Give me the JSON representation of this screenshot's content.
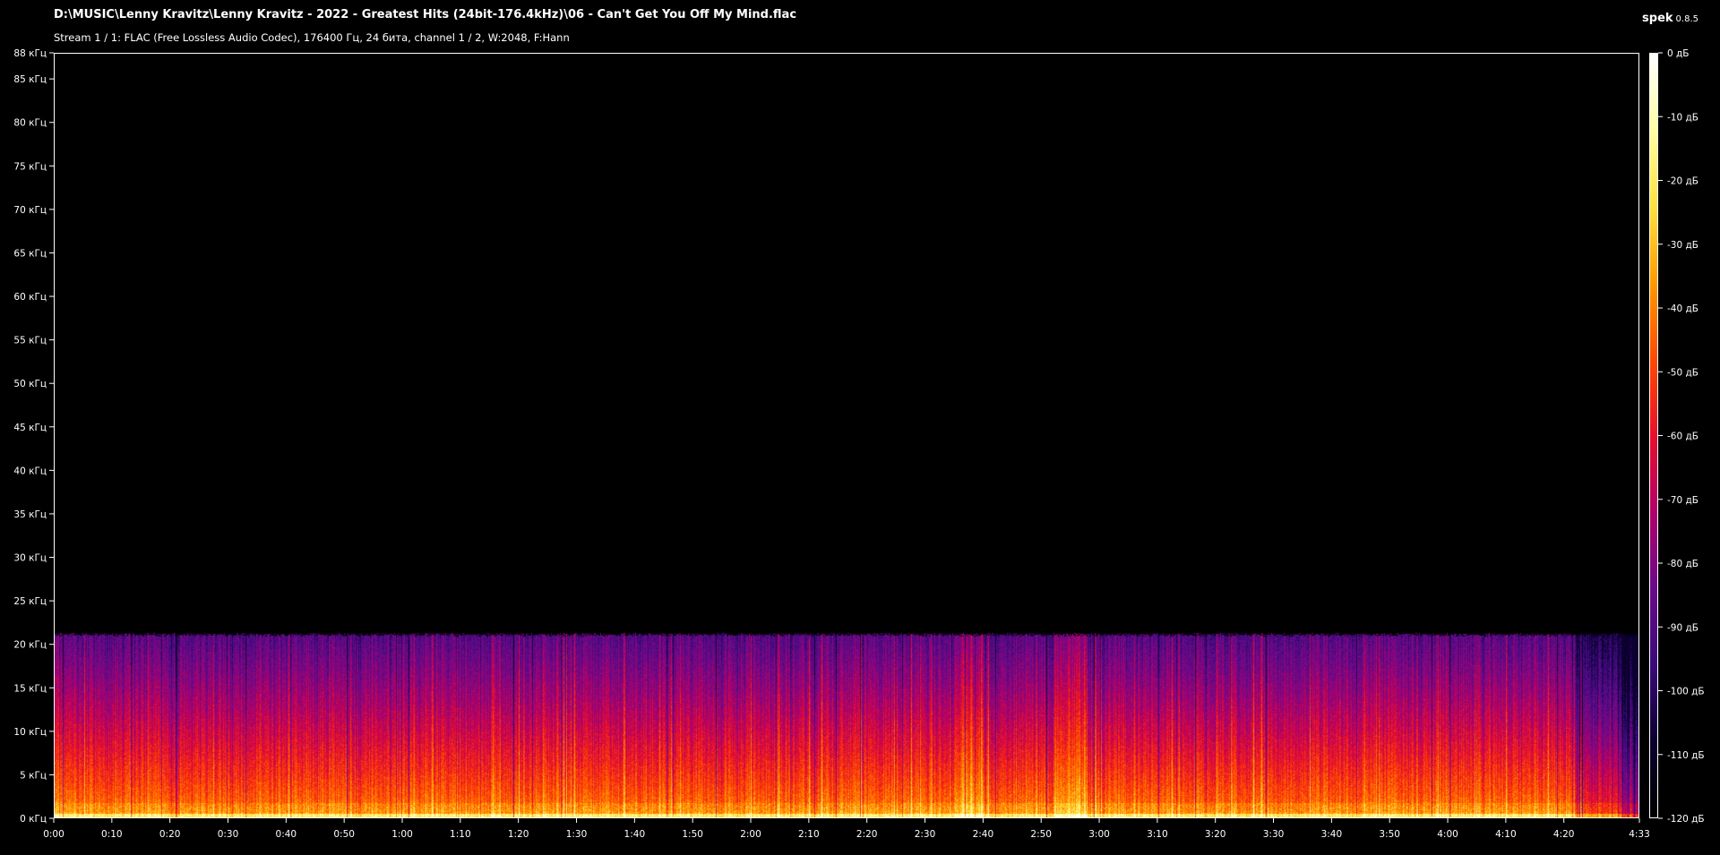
{
  "window": {
    "file_title": "D:\\MUSIC\\Lenny Kravitz\\Lenny Kravitz - 2022 - Greatest Hits (24bit-176.4kHz)\\06 - Can't Get You Off My Mind.flac",
    "stream_info": "Stream 1 / 1: FLAC (Free Lossless Audio Codec), 176400 Гц, 24 бита, channel 1 / 2, W:2048, F:Hann",
    "app_name": "spek",
    "app_version": "0.8.5"
  },
  "colors": {
    "background": "#000000",
    "axis": "#ffffff",
    "palette": [
      "#000000",
      "#0b0030",
      "#3a0a7a",
      "#6a0a8a",
      "#b0006a",
      "#e8102a",
      "#ff4a00",
      "#ff9a00",
      "#ffe040",
      "#ffffa0",
      "#ffffff"
    ]
  },
  "chart_data": {
    "type": "heatmap",
    "title": "",
    "xlabel": "",
    "ylabel": "",
    "x_ticks": [
      "0:00",
      "0:10",
      "0:20",
      "0:30",
      "0:40",
      "0:50",
      "1:00",
      "1:10",
      "1:20",
      "1:30",
      "1:40",
      "1:50",
      "2:00",
      "2:10",
      "2:20",
      "2:30",
      "2:40",
      "2:50",
      "3:00",
      "3:10",
      "3:20",
      "3:30",
      "3:40",
      "3:50",
      "4:00",
      "4:10",
      "4:20",
      "4:33"
    ],
    "x_range_seconds": [
      0,
      273
    ],
    "y_ticks": [
      "0 кГц",
      "5 кГц",
      "10 кГц",
      "15 кГц",
      "20 кГц",
      "25 кГц",
      "30 кГц",
      "35 кГц",
      "40 кГц",
      "45 кГц",
      "50 кГц",
      "55 кГц",
      "60 кГц",
      "65 кГц",
      "70 кГц",
      "75 кГц",
      "80 кГц",
      "85 кГц",
      "88 кГц"
    ],
    "y_range_khz": [
      0,
      88
    ],
    "colorbar_ticks": [
      "0 дБ",
      "-10 дБ",
      "-20 дБ",
      "-30 дБ",
      "-40 дБ",
      "-50 дБ",
      "-60 дБ",
      "-70 дБ",
      "-80 дБ",
      "-90 дБ",
      "-100 дБ",
      "-110 дБ",
      "-120 дБ"
    ],
    "colorbar_range_db": [
      -120,
      0
    ],
    "content_cutoff_khz": 21,
    "grid": false
  }
}
